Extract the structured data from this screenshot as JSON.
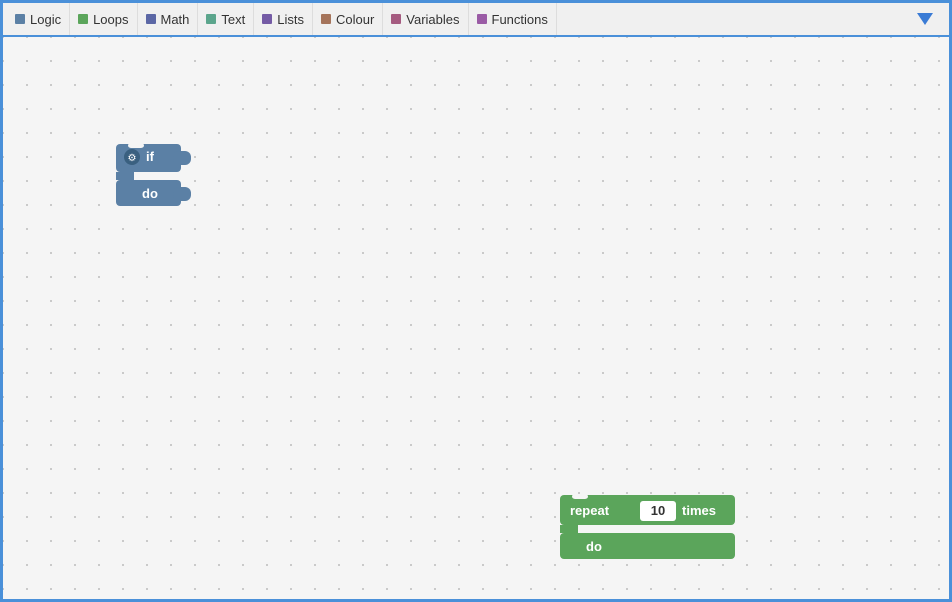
{
  "toolbar": {
    "items": [
      {
        "id": "logic",
        "label": "Logic",
        "color": "#5b80a5"
      },
      {
        "id": "loops",
        "label": "Loops",
        "color": "#5ba55b"
      },
      {
        "id": "math",
        "label": "Math",
        "color": "#5b67a5"
      },
      {
        "id": "text",
        "label": "Text",
        "color": "#5ba58c"
      },
      {
        "id": "lists",
        "label": "Lists",
        "color": "#745ba5"
      },
      {
        "id": "colour",
        "label": "Colour",
        "color": "#a5745b"
      },
      {
        "id": "variables",
        "label": "Variables",
        "color": "#a55b80"
      },
      {
        "id": "functions",
        "label": "Functions",
        "color": "#9a5ba5"
      }
    ]
  },
  "blocks": {
    "if_block": {
      "top_label": "if",
      "bottom_label": "do"
    },
    "repeat_block": {
      "top_label": "repeat",
      "value": "10",
      "value_suffix": "times",
      "bottom_label": "do"
    }
  }
}
